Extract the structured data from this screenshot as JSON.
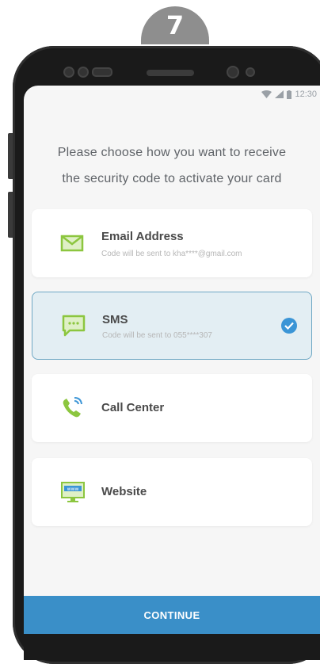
{
  "step_badge": "7",
  "status_bar": {
    "time": "12:30"
  },
  "intro_text": {
    "line1": "Please choose how you want to receive",
    "line2": "the security code to activate your card"
  },
  "options": [
    {
      "title": "Email Address",
      "subtitle": "Code will be sent to kha****@gmail.com",
      "icon": "mail-icon",
      "selected": false
    },
    {
      "title": "SMS",
      "subtitle": "Code will be sent to 055****307",
      "icon": "sms-bubble-icon",
      "selected": true
    },
    {
      "title": "Call Center",
      "subtitle": "",
      "icon": "phone-call-icon",
      "selected": false
    },
    {
      "title": "Website",
      "subtitle": "",
      "icon": "www-monitor-icon",
      "selected": false
    }
  ],
  "continue_label": "CONTINUE",
  "colors": {
    "accent": "#3a8fc8",
    "icon_green": "#8cc63f",
    "check_blue": "#3b95d6",
    "selected_bg": "#e3eef3"
  }
}
